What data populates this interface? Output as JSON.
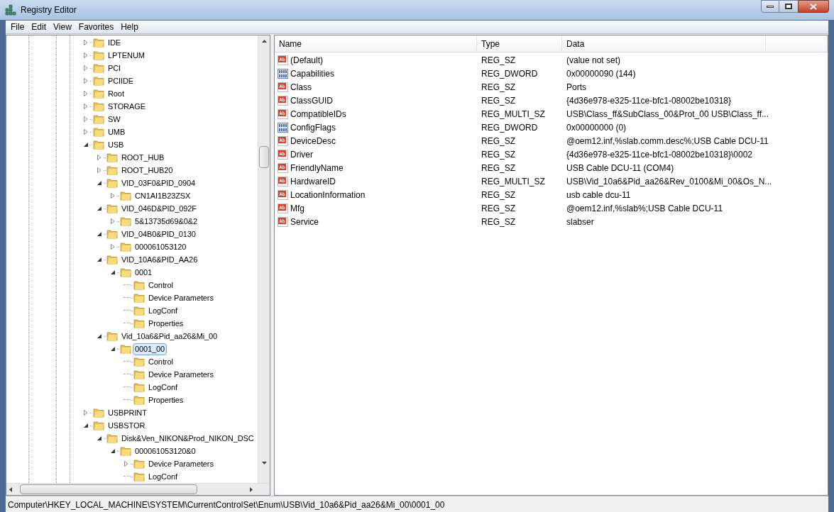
{
  "window": {
    "title": "Registry Editor"
  },
  "menu": [
    {
      "label": "File"
    },
    {
      "label": "Edit"
    },
    {
      "label": "View"
    },
    {
      "label": "Favorites"
    },
    {
      "label": "Help"
    }
  ],
  "tree": [
    {
      "label": "IDE",
      "expanded": false,
      "selected": false
    },
    {
      "label": "LPTENUM",
      "expanded": false,
      "selected": false
    },
    {
      "label": "PCI",
      "expanded": false,
      "selected": false
    },
    {
      "label": "PCIIDE",
      "expanded": false,
      "selected": false
    },
    {
      "label": "Root",
      "expanded": false,
      "selected": false
    },
    {
      "label": "STORAGE",
      "expanded": false,
      "selected": false
    },
    {
      "label": "SW",
      "expanded": false,
      "selected": false
    },
    {
      "label": "UMB",
      "expanded": false,
      "selected": false
    },
    {
      "label": "USB",
      "expanded": true,
      "selected": false,
      "children": [
        {
          "label": "ROOT_HUB",
          "expanded": false,
          "selected": false
        },
        {
          "label": "ROOT_HUB20",
          "expanded": false,
          "selected": false
        },
        {
          "label": "VID_03F0&PID_0904",
          "expanded": true,
          "selected": false,
          "children": [
            {
              "label": "CN1AI1B23ZSX",
              "expanded": false,
              "selected": false
            }
          ]
        },
        {
          "label": "VID_046D&PID_092F",
          "expanded": true,
          "selected": false,
          "children": [
            {
              "label": "5&13735d69&0&2",
              "expanded": false,
              "selected": false
            }
          ]
        },
        {
          "label": "VID_04B0&PID_0130",
          "expanded": true,
          "selected": false,
          "children": [
            {
              "label": "000061053120",
              "expanded": false,
              "selected": false
            }
          ]
        },
        {
          "label": "VID_10A6&PID_AA26",
          "expanded": true,
          "selected": false,
          "children": [
            {
              "label": "0001",
              "expanded": true,
              "selected": false,
              "children": [
                {
                  "label": "Control",
                  "selected": false
                },
                {
                  "label": "Device Parameters",
                  "selected": false
                },
                {
                  "label": "LogConf",
                  "selected": false
                },
                {
                  "label": "Properties",
                  "selected": false
                }
              ]
            }
          ]
        },
        {
          "label": "Vid_10a6&Pid_aa26&Mi_00",
          "expanded": true,
          "selected": false,
          "children": [
            {
              "label": "0001_00",
              "expanded": true,
              "selected": true,
              "children": [
                {
                  "label": "Control",
                  "selected": false
                },
                {
                  "label": "Device Parameters",
                  "selected": false
                },
                {
                  "label": "LogConf",
                  "selected": false
                },
                {
                  "label": "Properties",
                  "selected": false
                }
              ]
            }
          ]
        }
      ]
    },
    {
      "label": "USBPRINT",
      "expanded": false,
      "selected": false
    },
    {
      "label": "USBSTOR",
      "expanded": true,
      "selected": false,
      "children": [
        {
          "label": "Disk&Ven_NIKON&Prod_NIKON_DSC",
          "expanded": true,
          "selected": false,
          "children": [
            {
              "label": "000061053120&0",
              "expanded": true,
              "selected": false,
              "children": [
                {
                  "label": "Device Parameters",
                  "expanded": false,
                  "selected": false
                },
                {
                  "label": "LogConf",
                  "selected": false
                }
              ]
            }
          ]
        }
      ]
    }
  ],
  "values": {
    "columns": [
      "Name",
      "Type",
      "Data"
    ],
    "rows": [
      {
        "kind": "string",
        "name": "(Default)",
        "type": "REG_SZ",
        "data": "(value not set)"
      },
      {
        "kind": "binary",
        "name": "Capabilities",
        "type": "REG_DWORD",
        "data": "0x00000090 (144)"
      },
      {
        "kind": "string",
        "name": "Class",
        "type": "REG_SZ",
        "data": "Ports"
      },
      {
        "kind": "string",
        "name": "ClassGUID",
        "type": "REG_SZ",
        "data": "{4d36e978-e325-11ce-bfc1-08002be10318}"
      },
      {
        "kind": "string",
        "name": "CompatibleIDs",
        "type": "REG_MULTI_SZ",
        "data": "USB\\Class_ff&SubClass_00&Prot_00 USB\\Class_ff..."
      },
      {
        "kind": "binary",
        "name": "ConfigFlags",
        "type": "REG_DWORD",
        "data": "0x00000000 (0)"
      },
      {
        "kind": "string",
        "name": "DeviceDesc",
        "type": "REG_SZ",
        "data": "@oem12.inf,%slab.comm.desc%;USB Cable DCU-11"
      },
      {
        "kind": "string",
        "name": "Driver",
        "type": "REG_SZ",
        "data": "{4d36e978-e325-11ce-bfc1-08002be10318}\\0002"
      },
      {
        "kind": "string",
        "name": "FriendlyName",
        "type": "REG_SZ",
        "data": "USB Cable DCU-11 (COM4)"
      },
      {
        "kind": "string",
        "name": "HardwareID",
        "type": "REG_MULTI_SZ",
        "data": "USB\\Vid_10a6&Pid_aa26&Rev_0100&Mi_00&Os_N..."
      },
      {
        "kind": "string",
        "name": "LocationInformation",
        "type": "REG_SZ",
        "data": "usb cable dcu-11"
      },
      {
        "kind": "string",
        "name": "Mfg",
        "type": "REG_SZ",
        "data": "@oem12.inf,%slab%;USB Cable DCU-11"
      },
      {
        "kind": "string",
        "name": "Service",
        "type": "REG_SZ",
        "data": "slabser"
      }
    ]
  },
  "status_bar": "Computer\\HKEY_LOCAL_MACHINE\\SYSTEM\\CurrentControlSet\\Enum\\USB\\Vid_10a6&Pid_aa26&Mi_00\\0001_00"
}
